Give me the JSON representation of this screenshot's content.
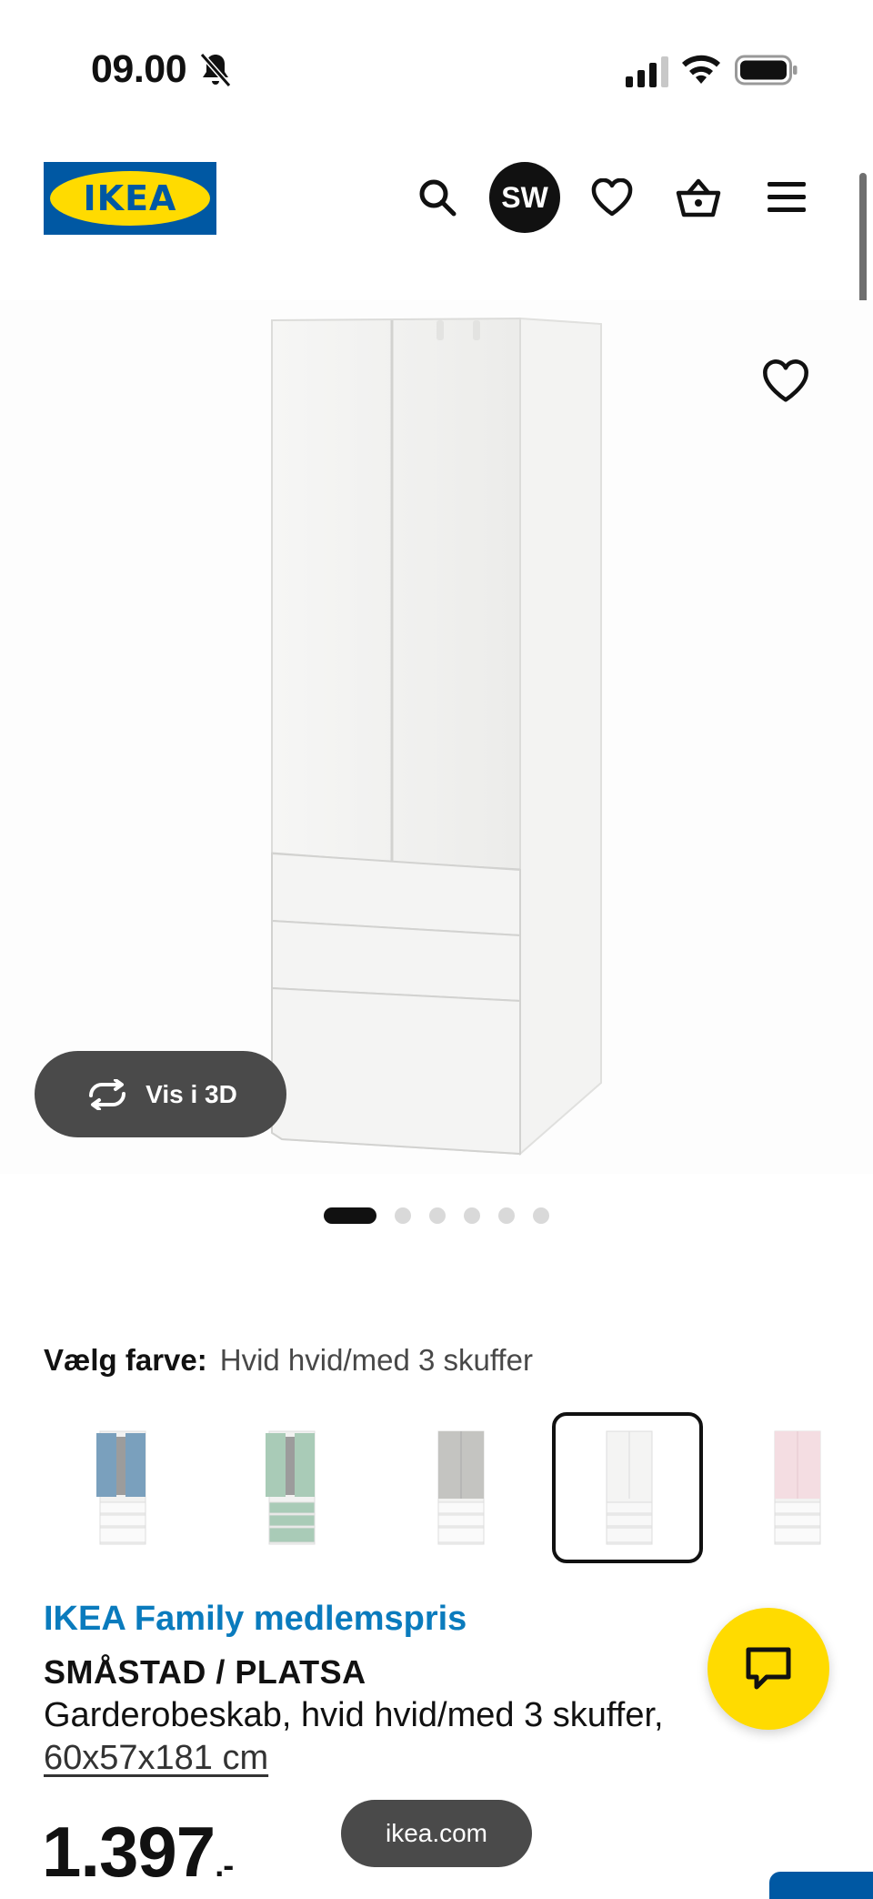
{
  "status_bar": {
    "time": "09.00"
  },
  "header": {
    "logo_text": "IKEA",
    "avatar_initials": "SW"
  },
  "gallery": {
    "view3d_label": "Vis i 3D",
    "image_count": 6,
    "active_index": 0
  },
  "color": {
    "label": "Vælg farve:",
    "value": "Hvid hvid/med 3 skuffer",
    "options": [
      {
        "name": "blå",
        "accent": "#7aa0bd"
      },
      {
        "name": "mint",
        "accent": "#a9cbb7"
      },
      {
        "name": "grå",
        "accent": "#c4c4c1"
      },
      {
        "name": "hvid",
        "accent": "#f2f2f0",
        "selected": true
      },
      {
        "name": "lyserød",
        "accent": "#f4dde2"
      }
    ]
  },
  "product": {
    "family_price_label": "IKEA Family medlemspris",
    "name": "SMÅSTAD / PLATSA",
    "description": "Garderobeskab, hvid hvid/med 3 skuffer,",
    "dimensions": "60x57x181 cm",
    "price": "1.397",
    "price_suffix": ".-"
  },
  "browser": {
    "url": "ikea.com"
  },
  "colors": {
    "ikea_blue": "#0058a3",
    "ikea_yellow": "#ffdb00",
    "family_blue": "#0a7bbd"
  }
}
